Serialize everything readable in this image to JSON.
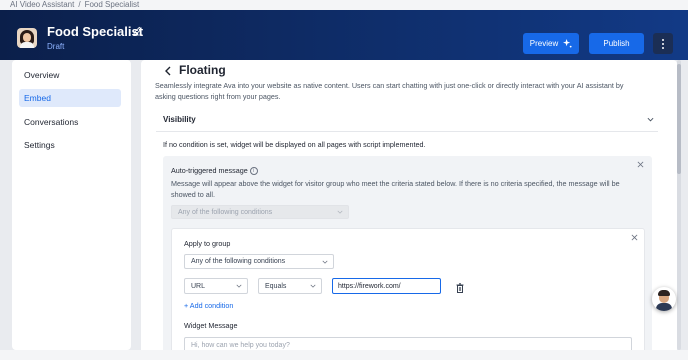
{
  "breadcrumb": {
    "parent": "AI Video Assistant",
    "separator": "/",
    "current": "Food Specialist"
  },
  "header": {
    "title": "Food Specialist",
    "status": "Draft",
    "preview_label": "Preview",
    "publish_label": "Publish"
  },
  "nav": {
    "items": [
      "Overview",
      "Embed",
      "Conversations",
      "Settings"
    ],
    "active": "Embed"
  },
  "main": {
    "title": "Floating",
    "description": "Seamlessly integrate Ava into your website as native content. Users can start chatting with just one-click or directly interact with your AI assistant by asking questions right from your pages.",
    "visibility": {
      "label": "Visibility",
      "note": "If no condition is set, widget will be displayed on all pages with script implemented."
    },
    "auto_trigger": {
      "title": "Auto-triggered message",
      "description": "Message will appear above the widget for visitor group who meet the criteria stated below. If there is no criteria specified, the message will be showed to all.",
      "condition_select": "Any of the following conditions",
      "group": {
        "label": "Apply to group",
        "condition_select": "Any of the following conditions",
        "rule": {
          "field": "URL",
          "operator": "Equals",
          "value": "https://firework.com/"
        },
        "add_condition": "+ Add condition",
        "widget_message_label": "Widget Message",
        "widget_message_placeholder": "Hi, how can we help you today?"
      }
    }
  },
  "colors": {
    "accent": "#1769e8",
    "header_dark": "#0b1f4a",
    "header_light": "#123a86",
    "nav_active_bg": "#dfe9fb"
  },
  "icons": {
    "edit": "pencil-icon",
    "preview": "sparkle-icon",
    "more": "kebab-icon",
    "back": "chevron-left-icon",
    "expand": "chevron-down-icon",
    "close": "close-icon",
    "info": "info-icon",
    "delete": "trash-icon"
  }
}
